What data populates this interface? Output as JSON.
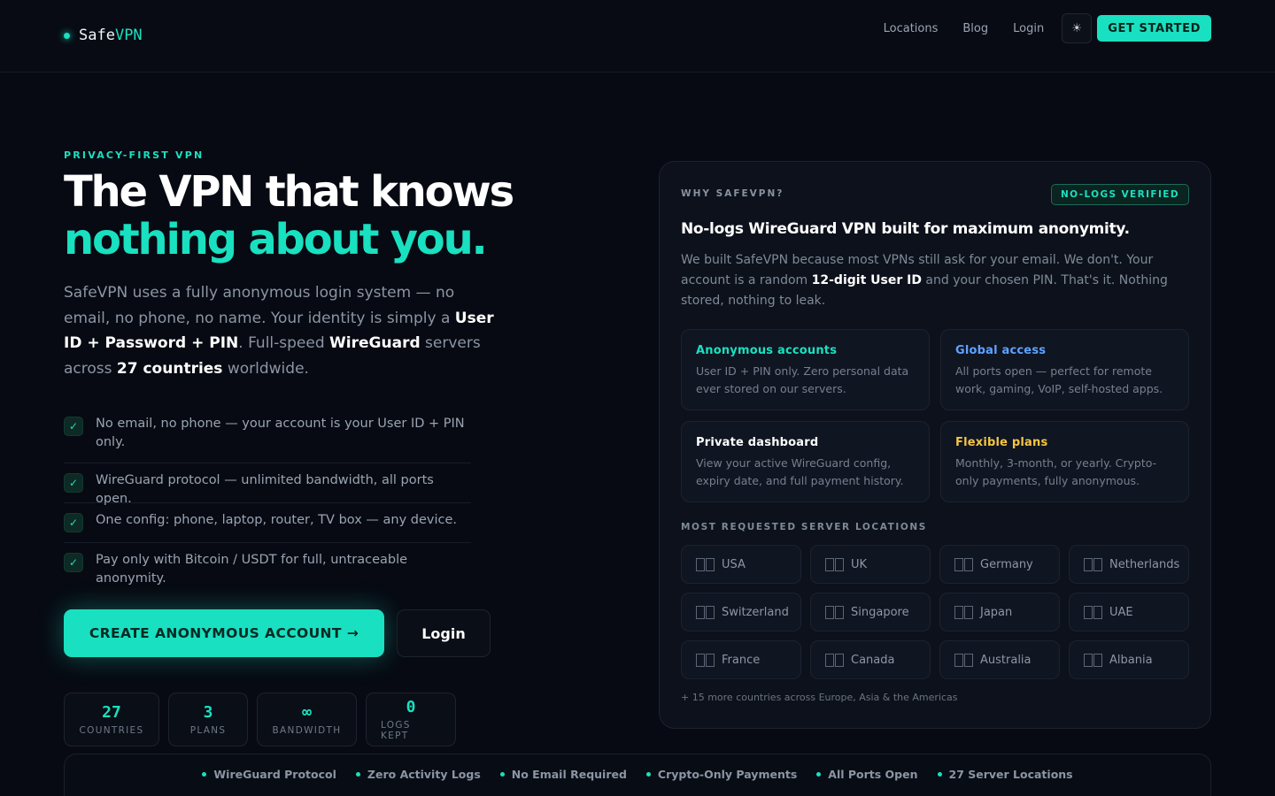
{
  "nav": {
    "brand_prefix": "Safe",
    "brand_suffix": "VPN",
    "links": [
      "Locations",
      "Blog",
      "Login"
    ],
    "theme_icon": "sun-icon",
    "cta_label": "GET STARTED"
  },
  "hero": {
    "eyebrow": "PRIVACY-FIRST VPN",
    "headline_line1": "The VPN that knows",
    "headline_line2": "nothing about you.",
    "lead_parts": {
      "p1": "SafeVPN uses a fully anonymous login system — no email, no phone, no name. Your identity is simply a ",
      "b1": "User ID + Password + PIN",
      "p2": ". Full-speed ",
      "b2": "WireGuard",
      "p3": " servers across ",
      "b3": "27 countries",
      "p4": " worldwide."
    },
    "checks": [
      "No email, no phone — your account is your User ID + PIN only.",
      "WireGuard protocol — unlimited bandwidth, all ports open.",
      "One config: phone, laptop, router, TV box — any device.",
      "Pay only with Bitcoin / USDT for full, untraceable anonymity."
    ],
    "create_label": "CREATE ANONYMOUS ACCOUNT →",
    "login_label": "Login",
    "stats": [
      {
        "value": "27",
        "label": "COUNTRIES"
      },
      {
        "value": "3",
        "label": "PLANS"
      },
      {
        "value": "∞",
        "label": "BANDWIDTH"
      },
      {
        "value": "0",
        "label": "LOGS KEPT"
      }
    ]
  },
  "card": {
    "eyebrow": "WHY SAFEVPN?",
    "badge": "NO-LOGS VERIFIED",
    "title": "No-logs WireGuard VPN built for maximum anonymity.",
    "desc_p1": "We built SafeVPN because most VPNs still ask for your email. We don't. Your account is a random ",
    "desc_b": "12-digit User ID",
    "desc_p2": " and your chosen PIN. That's it. Nothing stored, nothing to leak.",
    "features": [
      {
        "title": "Anonymous accounts",
        "text": "User ID + PIN only. Zero personal data ever stored on our servers.",
        "color": "#19e0c0"
      },
      {
        "title": "Global access",
        "text": "All ports open — perfect for remote work, gaming, VoIP, self-hosted apps.",
        "color": "#5ea2ff"
      },
      {
        "title": "Private dashboard",
        "text": "View your active WireGuard config, expiry date, and full payment history.",
        "color": "#ffffff"
      },
      {
        "title": "Flexible plans",
        "text": "Monthly, 3-month, or yearly. Crypto-only payments, fully anonymous.",
        "color": "#f5c542"
      }
    ],
    "locations_label": "MOST REQUESTED SERVER LOCATIONS",
    "locations": [
      "USA",
      "UK",
      "Germany",
      "Netherlands",
      "Switzerland",
      "Singapore",
      "Japan",
      "UAE",
      "France",
      "Canada",
      "Australia",
      "Albania"
    ],
    "footnote": "+ 15 more countries across Europe, Asia & the Americas"
  },
  "strip": [
    "WireGuard Protocol",
    "Zero Activity Logs",
    "No Email Required",
    "Crypto-Only Payments",
    "All Ports Open",
    "27 Server Locations"
  ]
}
